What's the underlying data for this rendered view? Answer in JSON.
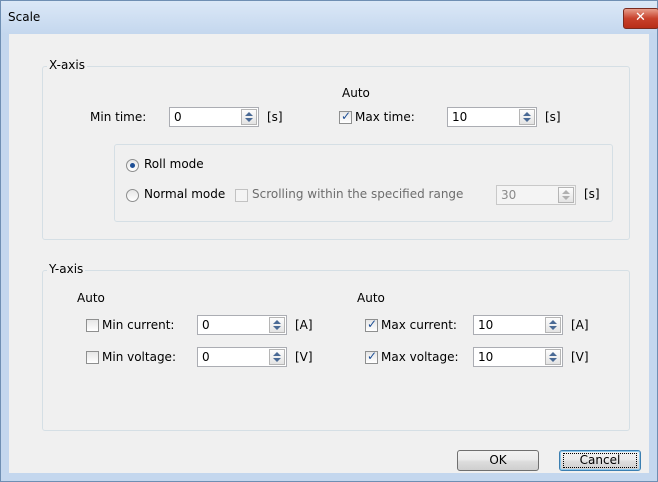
{
  "window": {
    "title": "Scale",
    "close_glyph": "✕"
  },
  "xaxis": {
    "legend": "X-axis",
    "auto_label": "Auto",
    "min_time": {
      "label": "Min time:",
      "value": "0",
      "unit": "[s]"
    },
    "max_time": {
      "label": "Max time:",
      "value": "10",
      "unit": "[s]",
      "auto_checked": true
    },
    "mode": {
      "roll_label": "Roll mode",
      "normal_label": "Normal mode",
      "selected": "roll",
      "scroll_label": "Scrolling within the specified range",
      "scroll_checked": false,
      "scroll_value": "30",
      "scroll_unit": "[s]"
    }
  },
  "yaxis": {
    "legend": "Y-axis",
    "auto_left": "Auto",
    "auto_right": "Auto",
    "min_current": {
      "label": "Min current:",
      "value": "0",
      "unit": "[A]",
      "checked": false
    },
    "min_voltage": {
      "label": "Min voltage:",
      "value": "0",
      "unit": "[V]",
      "checked": false
    },
    "max_current": {
      "label": "Max current:",
      "value": "10",
      "unit": "[A]",
      "checked": true
    },
    "max_voltage": {
      "label": "Max voltage:",
      "value": "10",
      "unit": "[V]",
      "checked": true
    }
  },
  "buttons": {
    "ok": "OK",
    "cancel": "Cancel"
  },
  "icons": {
    "check": "✓"
  },
  "colors": {
    "titlebar": "#c4d7ee",
    "close": "#c8412b",
    "accent": "#1d4e95"
  }
}
